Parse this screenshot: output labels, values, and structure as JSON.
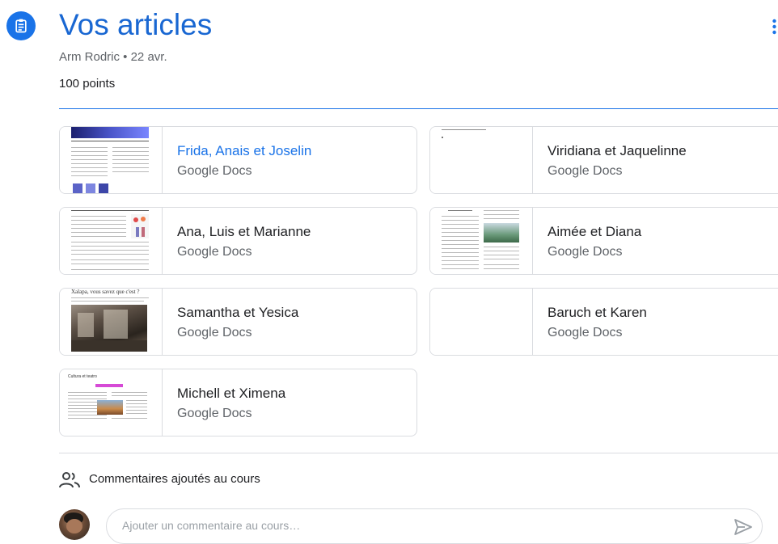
{
  "header": {
    "title": "Vos articles",
    "meta": "Arm Rodric • 22 avr.",
    "points": "100 points"
  },
  "attachments": [
    {
      "name": "Frida, Anais et Joselin",
      "type": "Google Docs",
      "highlighted": true
    },
    {
      "name": "Viridiana et Jaquelinne",
      "type": "Google Docs",
      "highlighted": false
    },
    {
      "name": "Ana, Luis et Marianne",
      "type": "Google Docs",
      "highlighted": false
    },
    {
      "name": "Aimée et Diana",
      "type": "Google Docs",
      "highlighted": false
    },
    {
      "name": "Samantha et Yesica",
      "type": "Google Docs",
      "highlighted": false
    },
    {
      "name": "Baruch et Karen",
      "type": "Google Docs",
      "highlighted": false
    },
    {
      "name": "Michell et Ximena",
      "type": "Google Docs",
      "highlighted": false
    }
  ],
  "thumbs": {
    "samantha_heading": "Xalapa, vous savez que c'est ?",
    "michell_heading": "Cultura et teatro"
  },
  "comments": {
    "label": "Commentaires ajoutés au cours",
    "placeholder": "Ajouter un commentaire au cours…"
  },
  "icons": {
    "header": "assignment-icon",
    "more": "more-vert-icon",
    "comments": "people-icon",
    "send": "send-icon"
  },
  "colors": {
    "accent": "#1a73e8",
    "title": "#1967d2",
    "border": "#dadce0"
  }
}
